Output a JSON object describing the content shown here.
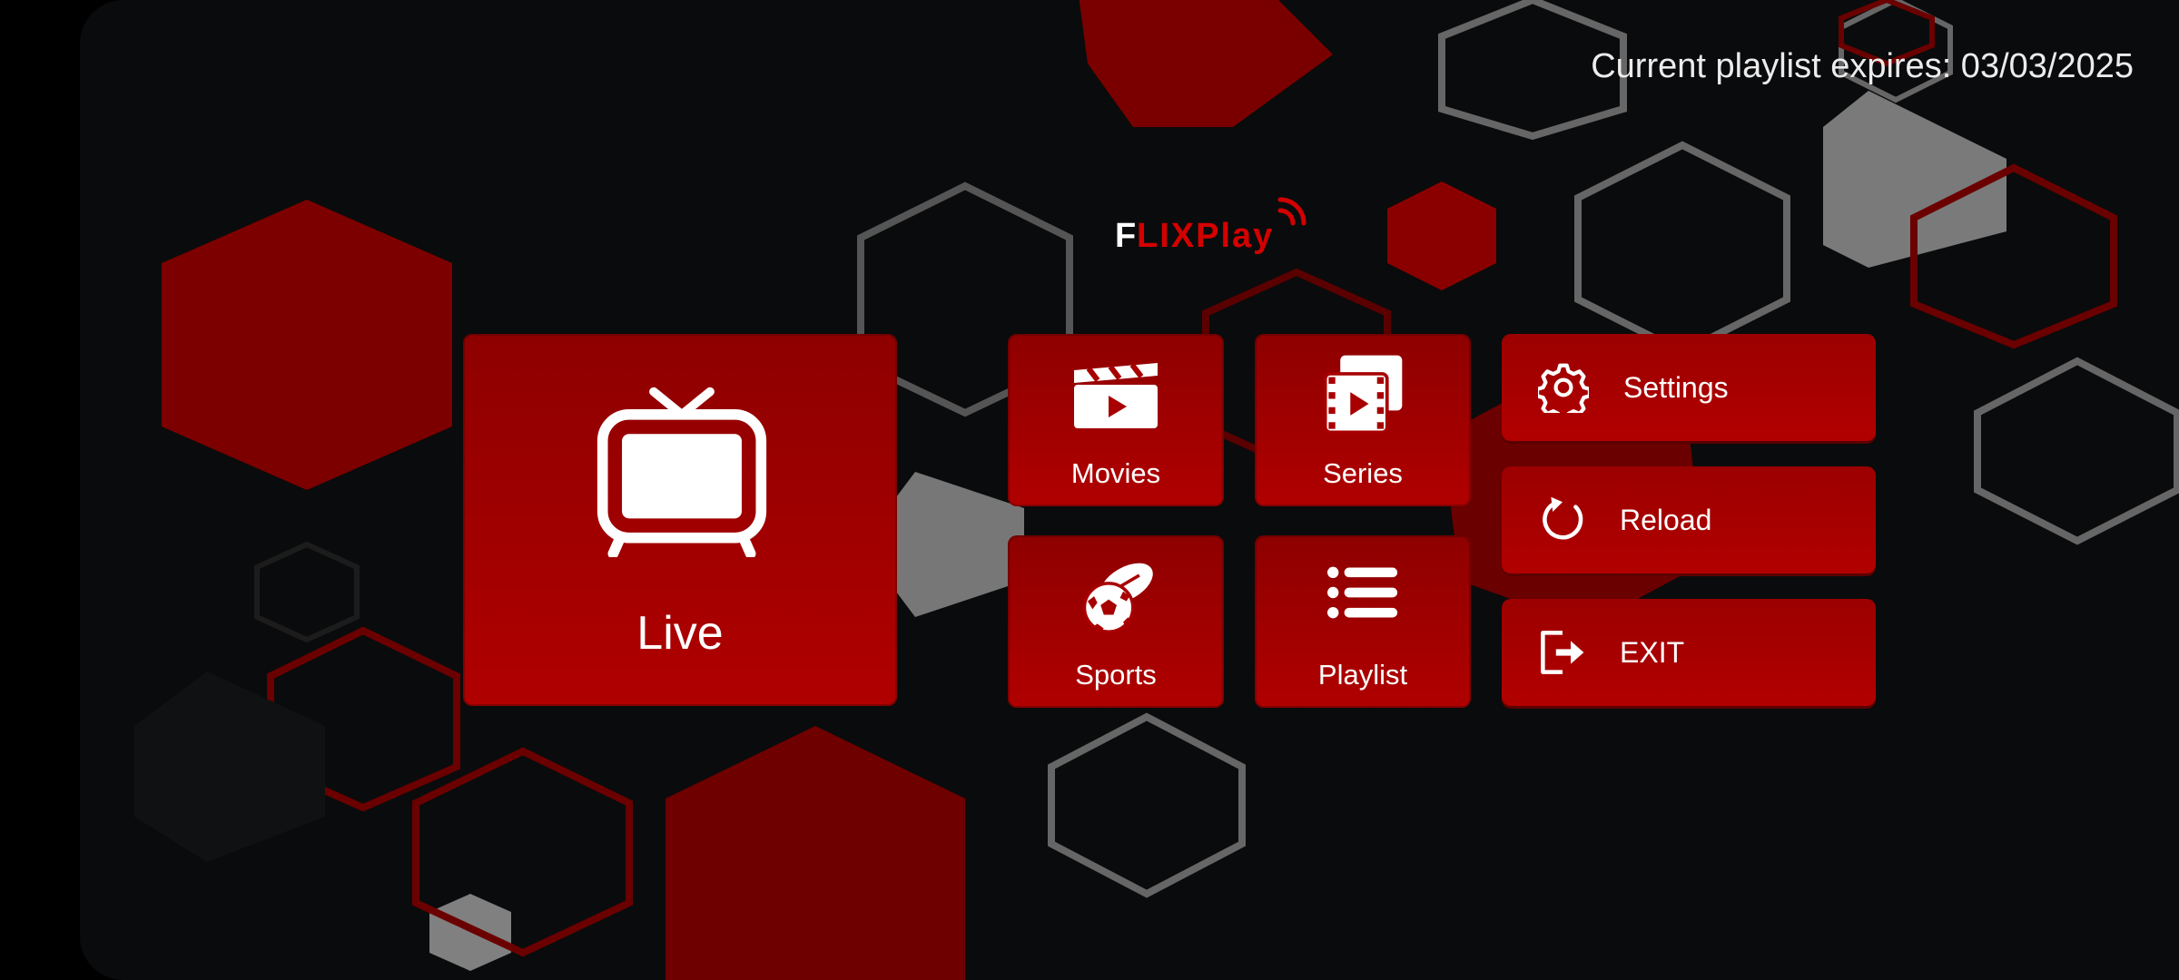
{
  "header": {
    "expiry_text": "Current playlist expires: 03/03/2025"
  },
  "logo": {
    "first_letter": "F",
    "rest": "LIXPlay"
  },
  "tiles": {
    "live": {
      "label": "Live",
      "icon": "tv-icon"
    },
    "movies": {
      "label": "Movies",
      "icon": "clapperboard-icon"
    },
    "series": {
      "label": "Series",
      "icon": "film-stack-icon"
    },
    "sports": {
      "label": "Sports",
      "icon": "sports-balls-icon"
    },
    "playlist": {
      "label": "Playlist",
      "icon": "list-icon"
    }
  },
  "side_menu": {
    "settings": {
      "label": "Settings",
      "icon": "gear-icon"
    },
    "reload": {
      "label": "Reload",
      "icon": "reload-icon"
    },
    "exit": {
      "label": "EXIT",
      "icon": "exit-icon"
    }
  },
  "colors": {
    "accent": "#b00000",
    "accent_dark": "#7a0000",
    "hex_gray": "#6d6d6d",
    "background": "#0a0b0c"
  }
}
